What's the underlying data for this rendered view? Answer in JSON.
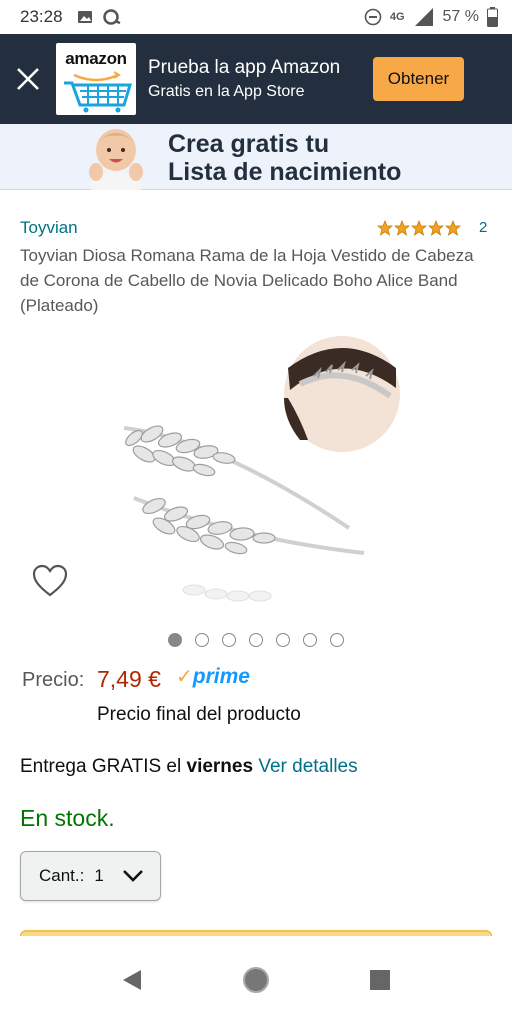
{
  "status_bar": {
    "time": "23:28",
    "network": "4G",
    "battery": "57 %"
  },
  "app_banner": {
    "logo_text": "amazon",
    "title": "Prueba la app Amazon",
    "subtitle": "Gratis en la App Store",
    "get_button": "Obtener"
  },
  "registry_banner": {
    "line1": "Crea gratis tu",
    "line2": "Lista de nacimiento"
  },
  "product": {
    "brand": "Toyvian",
    "rating_count": "2",
    "stars": 5,
    "title": "Toyvian Diosa Romana Rama de la Hoja Vestido de Cabeza de Corona de Cabello de Novia Delicado Boho Alice Band (Plateado)"
  },
  "gallery": {
    "image_count": 7,
    "active_index": 0
  },
  "price": {
    "label": "Precio:",
    "value": "7,49 €",
    "prime_label": "prime",
    "final_note": "Precio final del producto"
  },
  "delivery": {
    "prefix": "Entrega GRATIS el ",
    "day": "viernes",
    "details_link": "Ver detalles"
  },
  "stock": "En stock.",
  "quantity": {
    "label": "Cant.:",
    "value": "1"
  },
  "colors": {
    "banner_bg": "#232f3e",
    "accent_orange": "#f7a847",
    "link": "#007185",
    "price": "#b12704",
    "stock_green": "#007600",
    "prime_blue": "#1399ff"
  }
}
